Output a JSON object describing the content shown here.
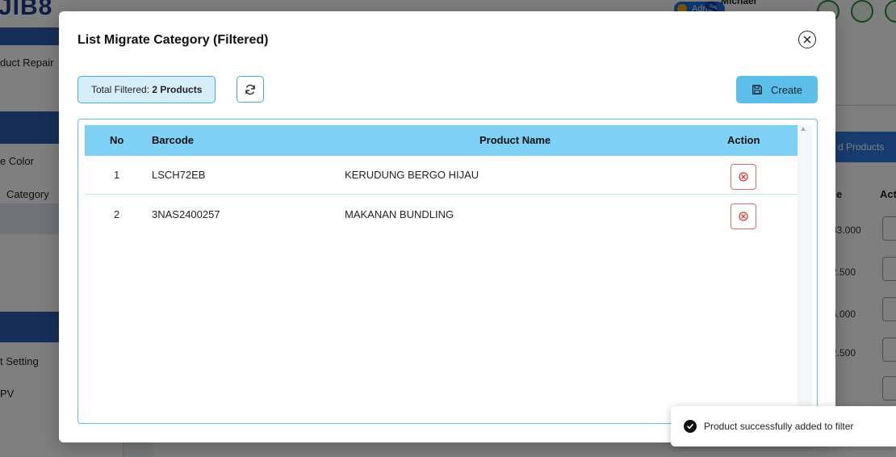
{
  "background": {
    "logo": "JIB8",
    "admin_badge": "Admin",
    "user_name": "Michael",
    "sidebar_items": [
      "duct Repair",
      "e Color",
      "Category",
      "t Setting",
      "PV"
    ],
    "tab_partial": "d Products",
    "column_partial_1": "e",
    "column_partial_2": "Act",
    "prices": [
      "33.000",
      "2.500",
      "5.000",
      "2.500"
    ]
  },
  "modal": {
    "title": "List Migrate Category (Filtered)",
    "total_label": "Total Filtered:",
    "total_value": "2 Products",
    "create_label": "Create",
    "close_icon": "close-circle-icon",
    "refresh_icon": "refresh-icon",
    "create_icon": "save-icon"
  },
  "table": {
    "headers": {
      "no": "No",
      "barcode": "Barcode",
      "product_name": "Product Name",
      "action": "Action"
    },
    "rows": [
      {
        "no": "1",
        "barcode": "LSCH72EB",
        "product_name": "KERUDUNG BERGO HIJAU"
      },
      {
        "no": "2",
        "barcode": "3NAS2400257",
        "product_name": "MAKANAN BUNDLING"
      }
    ]
  },
  "toast": {
    "message": "Product successfully added to filter",
    "icon": "check-circle-icon"
  },
  "colors": {
    "header_bg": "#7ed0f5",
    "create_bg": "#5bbfe9",
    "delete_border": "#e46a6a",
    "delete_icon": "#d83a3a"
  }
}
